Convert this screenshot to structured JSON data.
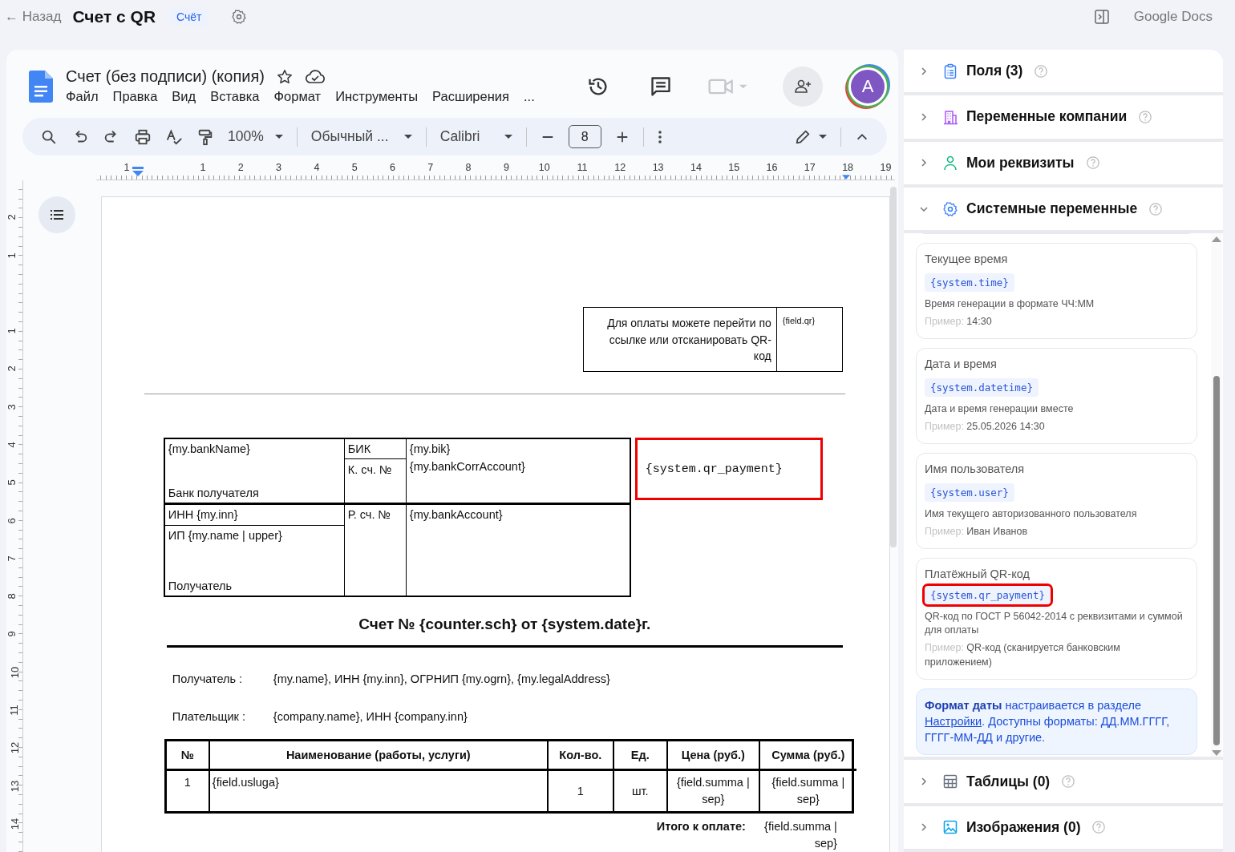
{
  "header": {
    "back_link": "← Назад",
    "title": "Счет с QR",
    "badge": "Счёт",
    "app_name": "Google Docs"
  },
  "doc": {
    "title": "Счет (без подписи) (копия)",
    "menus": [
      "Файл",
      "Правка",
      "Вид",
      "Вставка",
      "Формат",
      "Инструменты",
      "Расширения",
      "..."
    ],
    "avatar": "A",
    "toolbar": {
      "zoom": "100%",
      "style": "Обычный ...",
      "font": "Calibri",
      "font_size": "8"
    },
    "ruler": {
      "horizontal": [
        "1",
        "1",
        "2",
        "3",
        "4",
        "5",
        "6",
        "7",
        "8",
        "9",
        "10",
        "11",
        "12",
        "13",
        "14",
        "15",
        "16",
        "17",
        "18",
        "19"
      ],
      "vertical": [
        "2",
        "1",
        "1",
        "2",
        "3",
        "4",
        "5",
        "6",
        "7",
        "8",
        "9",
        "10",
        "11",
        "12",
        "13",
        "14"
      ]
    },
    "page": {
      "qr_note": {
        "text": "Для оплаты можете перейти по ссылке или отсканировать QR-код",
        "qr_field": "{field.qr}"
      },
      "bank": {
        "bank_name": "{my.bankName}",
        "bank_label": "Банк получателя",
        "bik_label": "БИК",
        "bik": "{my.bik}",
        "corr_label": "К. сч. №",
        "corr": "{my.bankCorrAccount}",
        "inn": "ИНН {my.inn}",
        "name": "ИП {my.name | upper}",
        "recipient_label": "Получатель",
        "account_label": "Р. сч. №",
        "account": "{my.bankAccount}",
        "qr_code": "{system.qr_payment}"
      },
      "invoice_title": "Счет № {counter.sch} от {system.date}г.",
      "parties": [
        {
          "label": "Получатель :",
          "value": "{my.name}, ИНН {my.inn}, ОГРНИП {my.ogrn}, {my.legalAddress}"
        },
        {
          "label": "Плательщик :",
          "value": "{company.name}, ИНН {company.inn}"
        }
      ],
      "items_table": {
        "columns": [
          "№",
          "Наименование (работы, услуги)",
          "Кол-во.",
          "Ед.",
          "Цена (руб.)",
          "Сумма (руб.)"
        ],
        "rows": [
          [
            "1",
            "{field.usluga}",
            "1",
            "шт.",
            "{field.summa | sep}",
            "{field.summa | sep}"
          ]
        ]
      },
      "total": {
        "label": "Итого к оплате:",
        "value": "{field.summa | sep}"
      }
    }
  },
  "panel": {
    "sections": [
      {
        "title": "Поля (3)",
        "kind": "clipboard",
        "expanded": false
      },
      {
        "title": "Переменные компании",
        "kind": "building",
        "expanded": false
      },
      {
        "title": "Мои реквизиты",
        "kind": "person",
        "expanded": false
      },
      {
        "title": "Системные переменные",
        "kind": "gear",
        "expanded": true,
        "variables": [
          {
            "title": "Текущее время",
            "code": "{system.time}",
            "description": "Время генерации в формате ЧЧ:ММ",
            "example_label": "Пример:",
            "example": "14:30",
            "highlighted": false
          },
          {
            "title": "Дата и время",
            "code": "{system.datetime}",
            "description": "Дата и время генерации вместе",
            "example_label": "Пример:",
            "example": "25.05.2026 14:30",
            "highlighted": false
          },
          {
            "title": "Имя пользователя",
            "code": "{system.user}",
            "description": "Имя текущего авторизованного пользователя",
            "example_label": "Пример:",
            "example": "Иван Иванов",
            "highlighted": false
          },
          {
            "title": "Платёжный QR-код",
            "code": "{system.qr_payment}",
            "description": "QR-код по ГОСТ Р 56042-2014 с реквизитами и суммой для оплаты",
            "example_label": "Пример:",
            "example": "QR-код (сканируется банковским приложением)",
            "highlighted": true
          }
        ],
        "note": {
          "text": "**Формат даты** настраивается в разделе",
          "link": "Настройки",
          "after": ". Доступны форматы: ДД.ММ.ГГГГ, ГГГГ-ММ-ДД и другие."
        }
      },
      {
        "title": "Таблицы (0)",
        "kind": "grid",
        "expanded": false
      },
      {
        "title": "Изображения (0)",
        "kind": "image",
        "expanded": false
      }
    ]
  }
}
